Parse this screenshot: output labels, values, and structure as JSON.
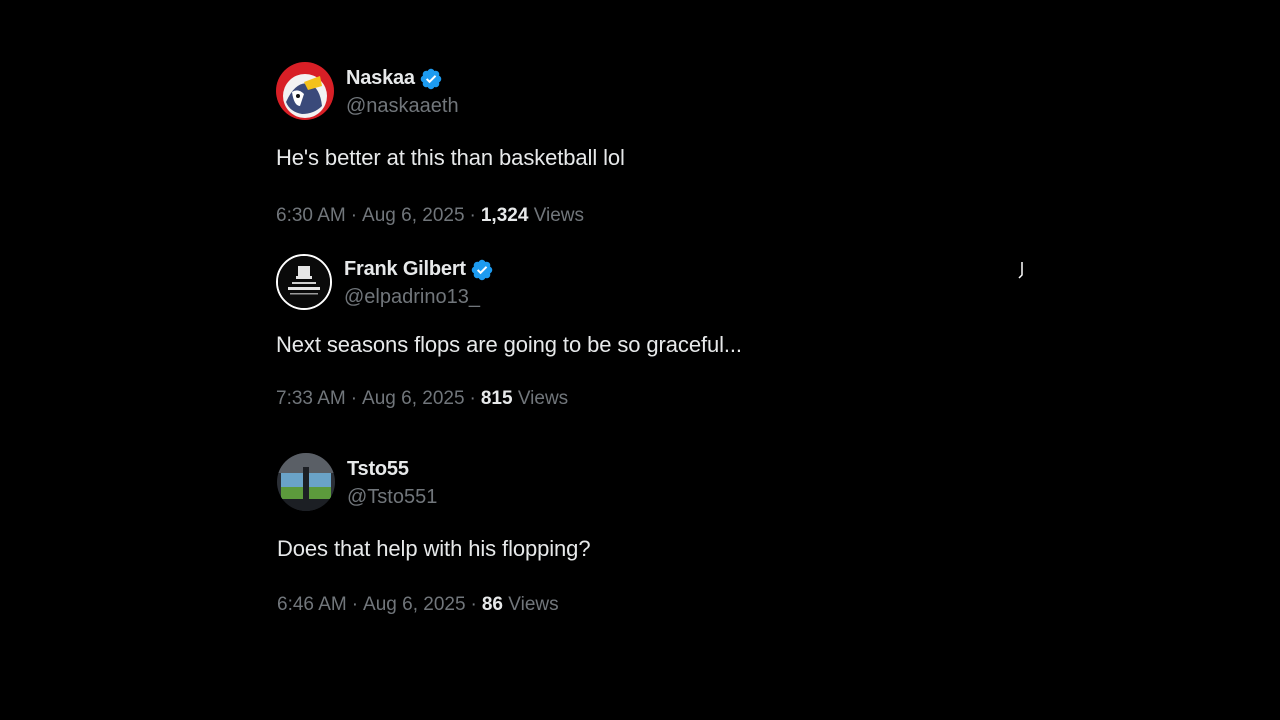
{
  "colors": {
    "background": "#000000",
    "text_primary": "#e7e9ea",
    "text_secondary": "#71767b",
    "verified_badge": "#1d9bf0"
  },
  "tweets": [
    {
      "display_name": "Naskaa",
      "verified": true,
      "handle": "@naskaaeth",
      "text": "He's better at this than basketball lol",
      "time": "6:30 AM",
      "date": "Aug 6, 2025",
      "views_count": "1,324",
      "views_label": "Views",
      "separator": "·"
    },
    {
      "display_name": "Frank Gilbert",
      "verified": true,
      "handle": "@elpadrino13_",
      "text": "Next seasons flops are going to be so graceful...",
      "time": "7:33 AM",
      "date": "Aug 6, 2025",
      "views_count": "815",
      "views_label": "Views",
      "separator": "·"
    },
    {
      "display_name": "Tsto55",
      "verified": false,
      "handle": "@Tsto551",
      "text": "Does that help with his flopping?",
      "time": "6:46 AM",
      "date": "Aug 6, 2025",
      "views_count": "86",
      "views_label": "Views",
      "separator": "·"
    }
  ]
}
